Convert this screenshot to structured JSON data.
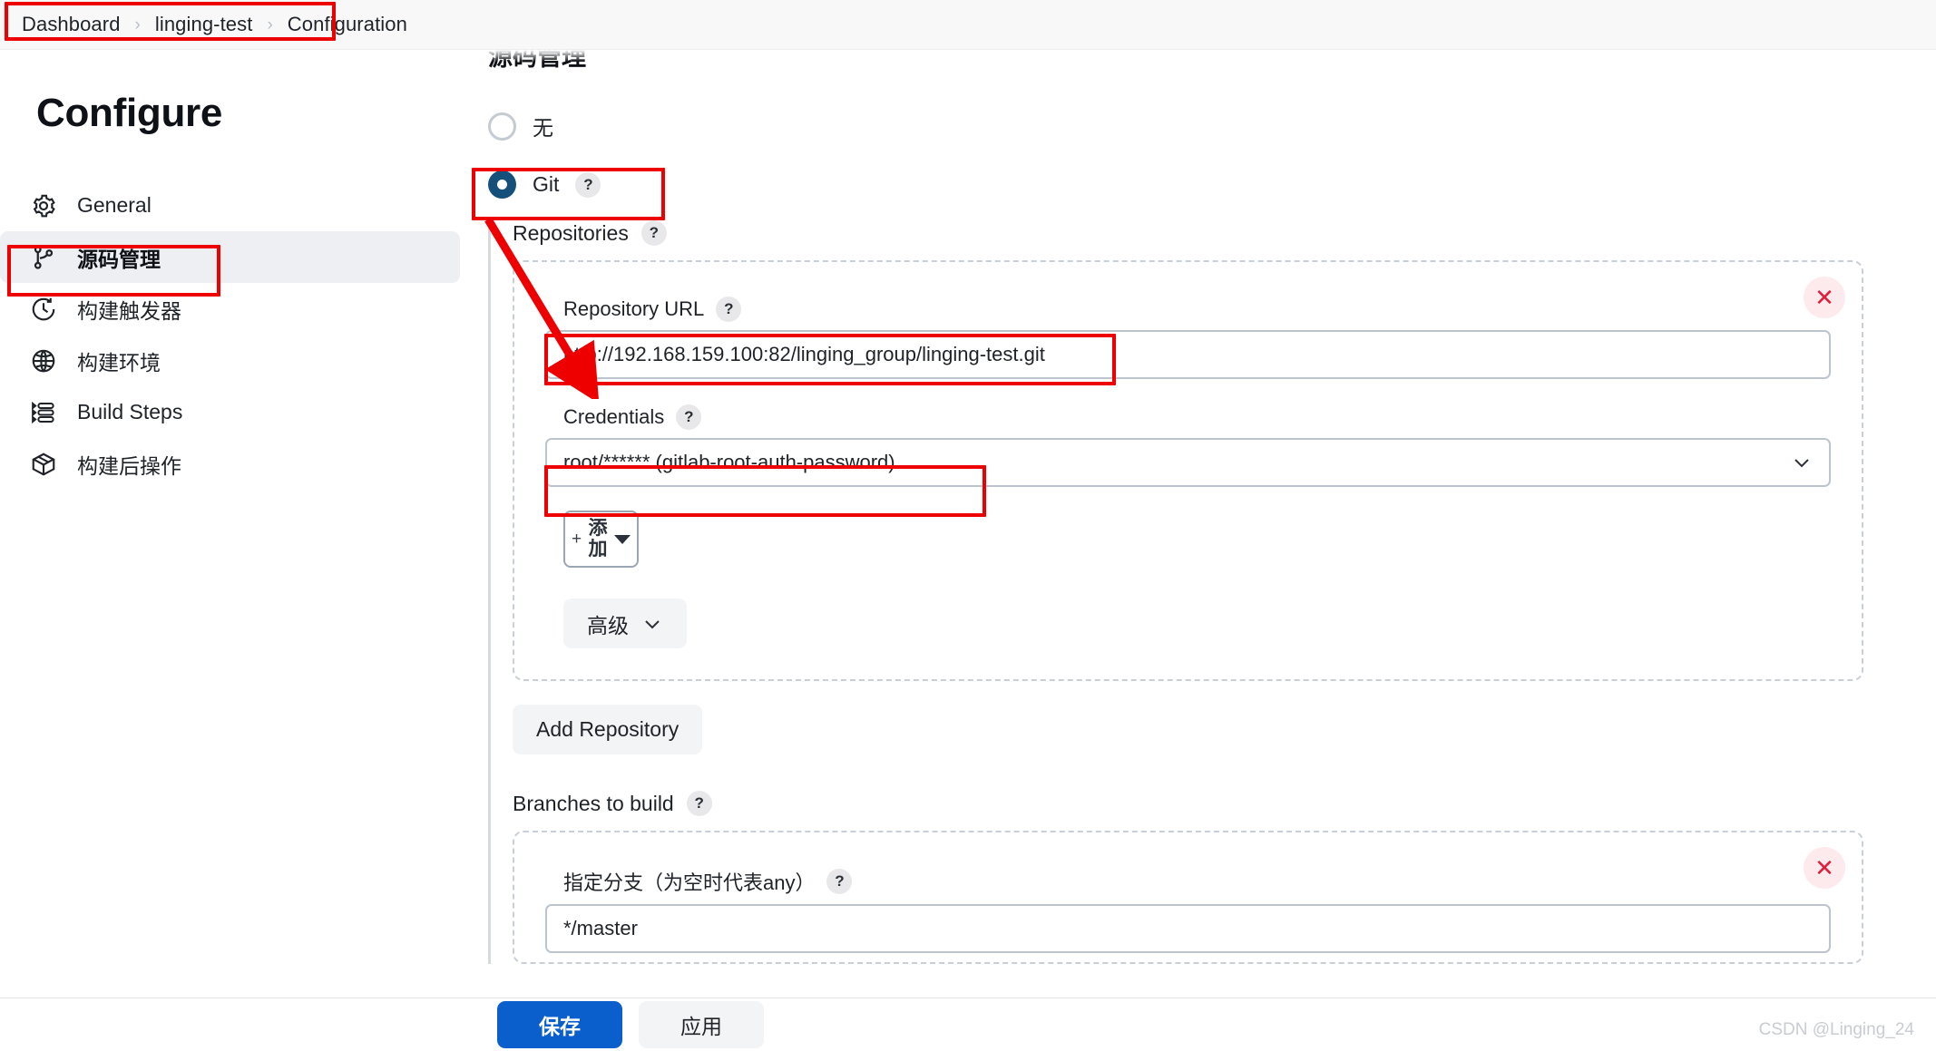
{
  "breadcrumb": {
    "items": [
      "Dashboard",
      "linging-test",
      "Configuration"
    ],
    "separator": "›"
  },
  "sidebar": {
    "title": "Configure",
    "items": [
      {
        "label": "General",
        "icon": "gear-icon",
        "active": false
      },
      {
        "label": "源码管理",
        "icon": "git-branch-icon",
        "active": true
      },
      {
        "label": "构建触发器",
        "icon": "clock-icon",
        "active": false
      },
      {
        "label": "构建环境",
        "icon": "globe-icon",
        "active": false
      },
      {
        "label": "Build Steps",
        "icon": "list-steps-icon",
        "active": false
      },
      {
        "label": "构建后操作",
        "icon": "package-icon",
        "active": false
      }
    ]
  },
  "main": {
    "section_heading": "源码管理",
    "scm_options": [
      {
        "label": "无",
        "selected": false,
        "help": ""
      },
      {
        "label": "Git",
        "selected": true,
        "help": "?"
      }
    ],
    "repositories_label": "Repositories",
    "help_glyph": "?",
    "repository": {
      "remove_glyph": "✕",
      "url_label": "Repository URL",
      "url_value": "http://192.168.159.100:82/linging_group/linging-test.git",
      "credentials_label": "Credentials",
      "credentials_value": "root/****** (gitlab-root-auth-password)",
      "add_button": {
        "plus": "+",
        "label": "添加"
      },
      "advanced_button": "高级"
    },
    "add_repository_button": "Add Repository",
    "branches_label": "Branches to build",
    "branch": {
      "remove_glyph": "✕",
      "specifier_label": "指定分支（为空时代表any）",
      "specifier_value": "*/master"
    }
  },
  "footer": {
    "save_label": "保存",
    "apply_label": "应用"
  },
  "watermark": "CSDN @Linging_24",
  "colors": {
    "accent_blue": "#0a5fcc",
    "radio_selected": "#14507a",
    "annotation_red": "#ee0000",
    "remove_red": "#e01e3c"
  }
}
